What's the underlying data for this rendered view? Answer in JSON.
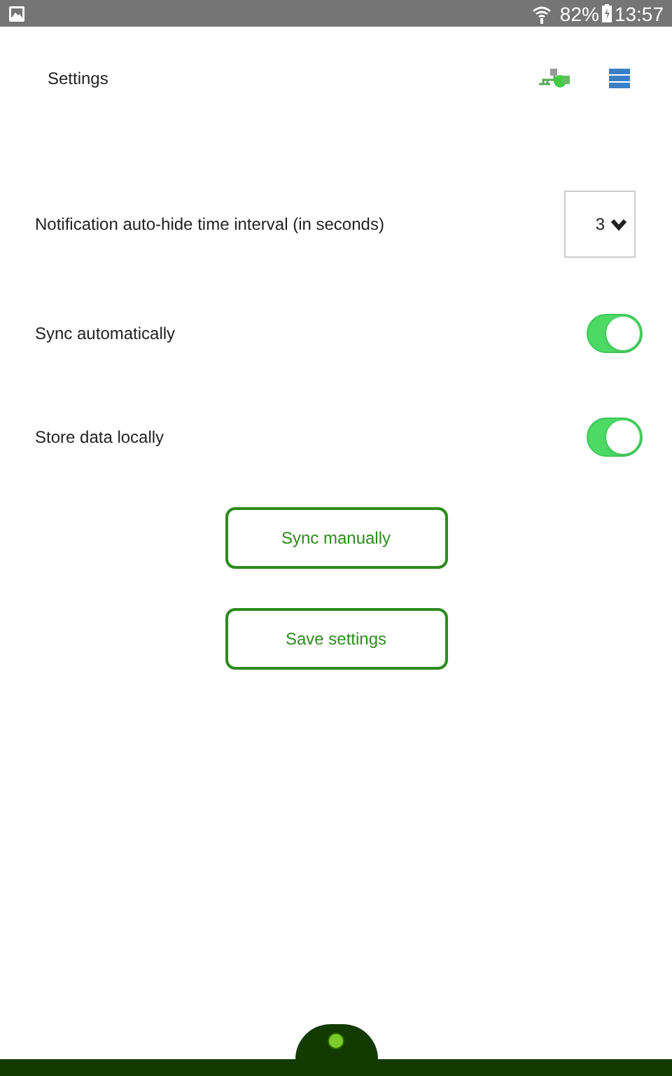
{
  "status_bar": {
    "battery": "82%",
    "time": "13:57"
  },
  "header": {
    "title": "Settings"
  },
  "settings": [
    {
      "kind": "select",
      "label": "Notification auto-hide time interval (in seconds)",
      "value": "3"
    },
    {
      "kind": "toggle",
      "label": "Sync automatically",
      "on": true
    },
    {
      "kind": "toggle",
      "label": "Store data locally",
      "on": true
    }
  ],
  "buttons": [
    "Sync manually",
    "Save settings"
  ]
}
